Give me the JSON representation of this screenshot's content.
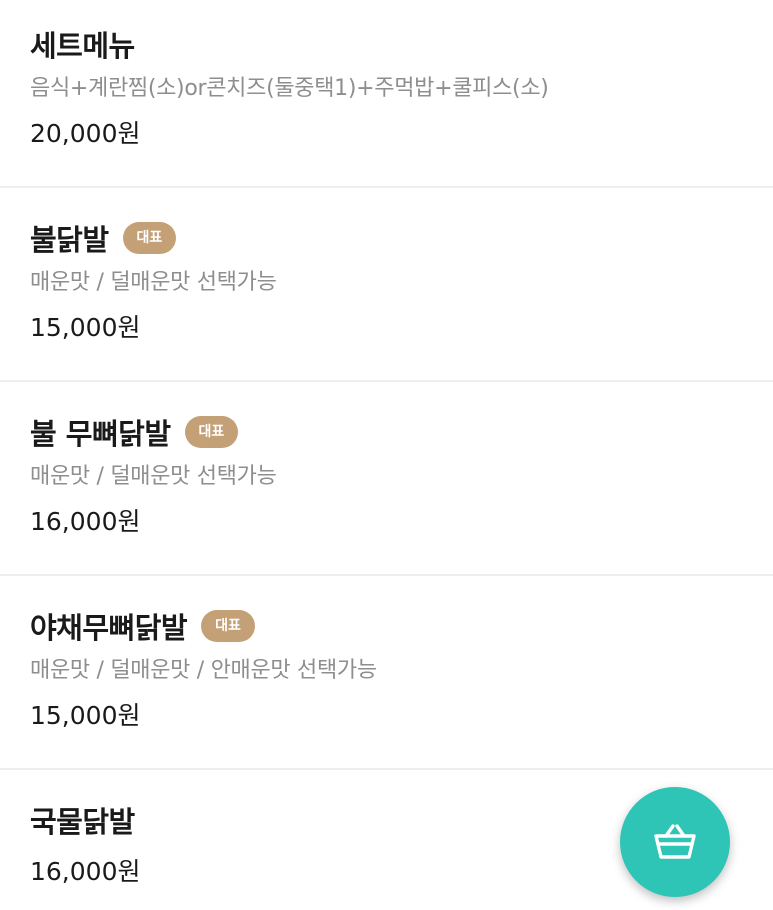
{
  "menu": {
    "items": [
      {
        "name": "세트메뉴",
        "badge": "",
        "description": "음식+계란찜(소)or콘치즈(둘중택1)+주먹밥+쿨피스(소)",
        "price": "20,000원"
      },
      {
        "name": "불닭발",
        "badge": "대표",
        "description": "매운맛 / 덜매운맛 선택가능",
        "price": "15,000원"
      },
      {
        "name": "불 무뼈닭발",
        "badge": "대표",
        "description": "매운맛 / 덜매운맛 선택가능",
        "price": "16,000원"
      },
      {
        "name": "야채무뼈닭발",
        "badge": "대표",
        "description": "매운맛 / 덜매운맛 / 안매운맛 선택가능",
        "price": "15,000원"
      },
      {
        "name": "국물닭발",
        "badge": "",
        "description": "",
        "price": "16,000원"
      }
    ]
  },
  "cart_button": {
    "icon": "basket-icon",
    "color": "#2ec4b6"
  },
  "colors": {
    "badge": "#c4a077",
    "description": "#8e8e8e",
    "divider": "#eeeeee"
  }
}
